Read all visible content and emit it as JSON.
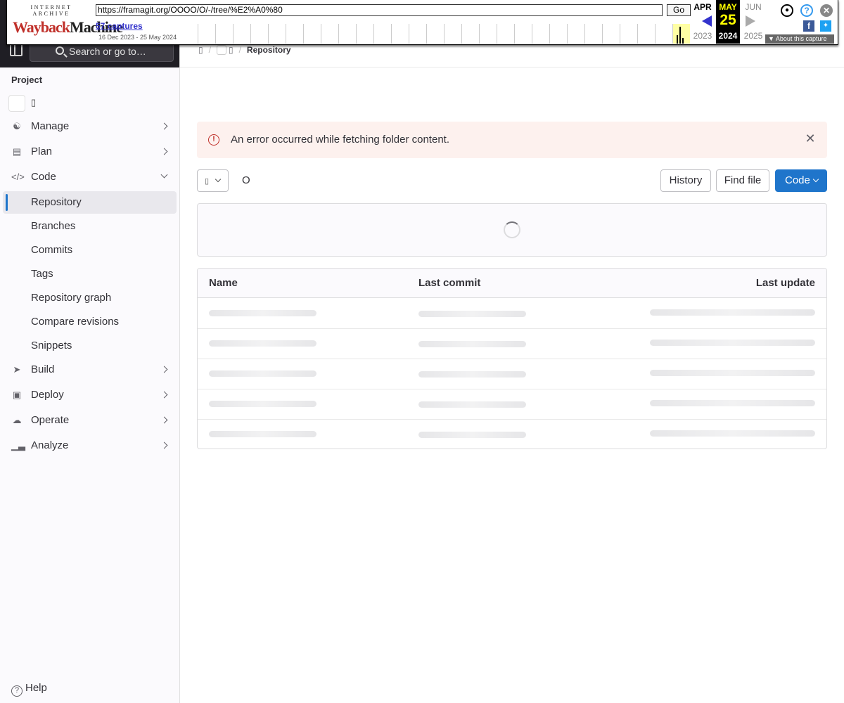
{
  "wayback": {
    "logo_top": "INTERNET ARCHIVE",
    "logo_main_a": "Wayback",
    "logo_main_b": "Machine",
    "url": "https://framagit.org/OOOO/O/-/tree/%E2%A0%80",
    "go_label": "Go",
    "captures": "57 captures",
    "range": "16 Dec 2023 - 25 May 2024",
    "prev_month": "APR",
    "prev_year": "2023",
    "cur_month": "MAY",
    "cur_day": "25",
    "cur_year": "2024",
    "next_month": "JUN",
    "next_year": "2025",
    "about": "About this capture"
  },
  "sidebar": {
    "search_placeholder": "Search or go to…",
    "section_label": "Project",
    "project_name": "▯",
    "items": [
      {
        "label": "Manage",
        "icon": "users-icon"
      },
      {
        "label": "Plan",
        "icon": "calendar-icon"
      },
      {
        "label": "Code",
        "icon": "code-icon"
      },
      {
        "label": "Repository"
      },
      {
        "label": "Branches"
      },
      {
        "label": "Commits"
      },
      {
        "label": "Tags"
      },
      {
        "label": "Repository graph"
      },
      {
        "label": "Compare revisions"
      },
      {
        "label": "Snippets"
      },
      {
        "label": "Build",
        "icon": "rocket-icon"
      },
      {
        "label": "Deploy",
        "icon": "deploy-icon"
      },
      {
        "label": "Operate",
        "icon": "cloud-icon"
      },
      {
        "label": "Analyze",
        "icon": "chart-icon"
      }
    ],
    "help": "Help"
  },
  "breadcrumb": {
    "current": "Repository"
  },
  "alert": {
    "message": "An error occurred while fetching folder content."
  },
  "toolbar": {
    "path": "O",
    "history": "History",
    "find_file": "Find file",
    "code": "Code"
  },
  "table": {
    "columns": [
      "Name",
      "Last commit",
      "Last update"
    ]
  },
  "colors": {
    "accent": "#1f75cb",
    "danger": "#c0302a",
    "alert_bg": "#fdf1ee"
  }
}
